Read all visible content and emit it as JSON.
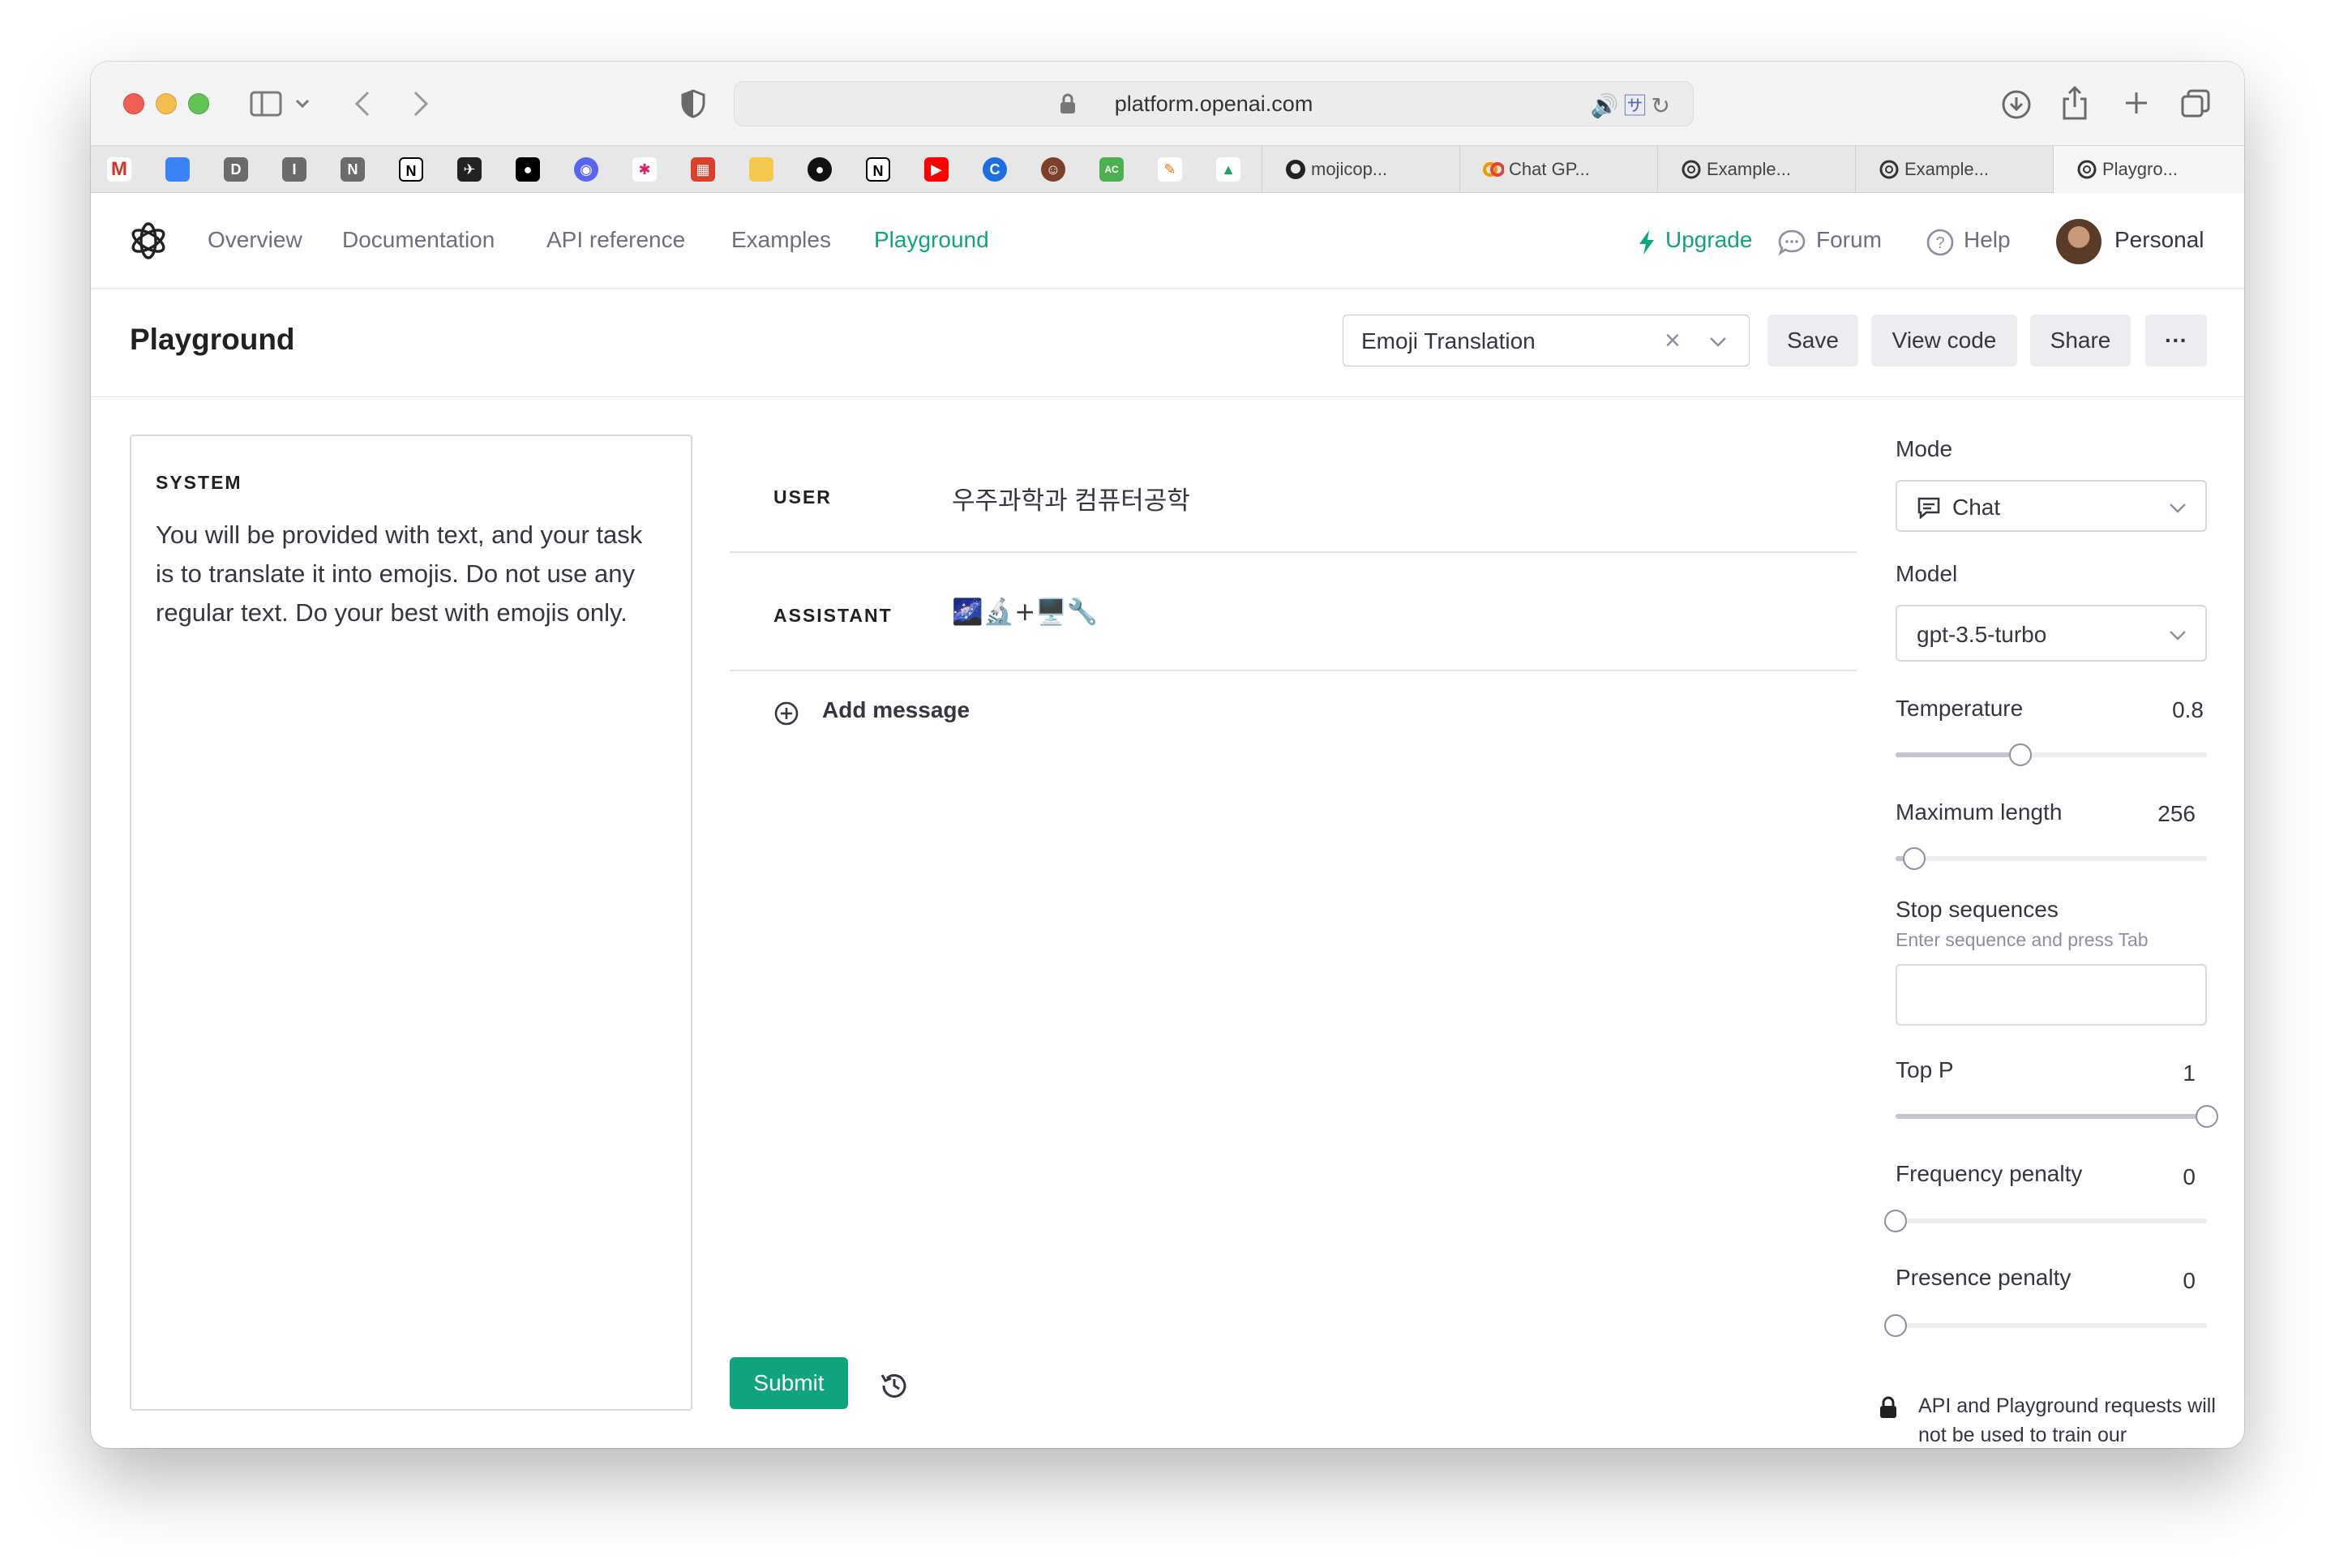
{
  "browser": {
    "url": "platform.openai.com",
    "tabs": [
      {
        "title": "mojicop..."
      },
      {
        "title": "Chat GP..."
      },
      {
        "title": "Example..."
      },
      {
        "title": "Example..."
      },
      {
        "title": "Playgro..."
      }
    ]
  },
  "header": {
    "nav": [
      {
        "label": "Overview"
      },
      {
        "label": "Documentation"
      },
      {
        "label": "API reference"
      },
      {
        "label": "Examples"
      },
      {
        "label": "Playground"
      }
    ],
    "upgrade": "Upgrade",
    "forum": "Forum",
    "help": "Help",
    "account": "Personal"
  },
  "toolbar": {
    "title": "Playground",
    "preset": "Emoji Translation",
    "save": "Save",
    "view_code": "View code",
    "share": "Share",
    "more": "···"
  },
  "system": {
    "label": "SYSTEM",
    "text": "You will be provided with text, and your task is to translate it into emojis. Do not use any regular text. Do your best with emojis only."
  },
  "messages": [
    {
      "role": "USER",
      "content": "우주과학과 컴퓨터공학"
    },
    {
      "role": "ASSISTANT",
      "content": "🌌🔬+🖥️🔧"
    }
  ],
  "add_message": "Add message",
  "submit": "Submit",
  "settings": {
    "mode": {
      "label": "Mode",
      "value": "Chat"
    },
    "model": {
      "label": "Model",
      "value": "gpt-3.5-turbo"
    },
    "temperature": {
      "label": "Temperature",
      "value": "0.8",
      "fraction": 0.4
    },
    "max_length": {
      "label": "Maximum length",
      "value": "256",
      "fraction": 0.06
    },
    "stop_sequences": {
      "label": "Stop sequences",
      "hint": "Enter sequence and press Tab"
    },
    "top_p": {
      "label": "Top P",
      "value": "1",
      "fraction": 1.0
    },
    "frequency_penalty": {
      "label": "Frequency penalty",
      "value": "0",
      "fraction": 0.0
    },
    "presence_penalty": {
      "label": "Presence penalty",
      "value": "0",
      "fraction": 0.0
    }
  },
  "notice": "API and Playground requests will not be used to train our",
  "colors": {
    "accent": "#10a37f"
  }
}
